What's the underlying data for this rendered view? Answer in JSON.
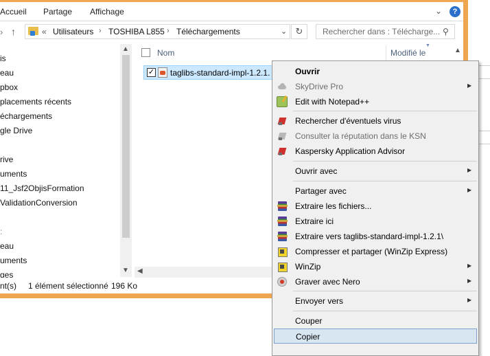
{
  "ribbon": {
    "tabs": [
      "Accueil",
      "Partage",
      "Affichage"
    ],
    "expand_icon": "chevron-down-icon",
    "help_glyph": "?"
  },
  "address": {
    "prefix": "«",
    "crumbs": [
      "Utilisateurs",
      "TOSHIBA L855",
      "Téléchargements"
    ],
    "separator": "›",
    "refresh_icon": "refresh-icon"
  },
  "search": {
    "placeholder": "Rechercher dans : Télécharge..."
  },
  "nav": {
    "items": [
      "is",
      "eau",
      "pbox",
      "placements récents",
      "échargements",
      "gle Drive",
      "",
      "rive",
      "uments",
      "11_Jsf2ObjisFormation",
      "ValidationConversion",
      "",
      "",
      "eau",
      "uments",
      "ges"
    ]
  },
  "files": {
    "columns": {
      "name": "Nom",
      "date": "Modifié le"
    },
    "rows": [
      {
        "name": "taglibs-standard-impl-1.2.1.",
        "checked": true
      }
    ]
  },
  "status": {
    "left": "nt(s)",
    "selection": "1 élément sélectionné",
    "size": "196 Ko"
  },
  "context_menu": {
    "items": [
      {
        "label": "Ouvrir",
        "bold": true,
        "icon": ""
      },
      {
        "label": "SkyDrive Pro",
        "disabled": true,
        "submenu": true,
        "icon": "cloud-icon"
      },
      {
        "label": "Edit with Notepad++",
        "icon": "notepad-plus-plus-icon"
      },
      {
        "label": "Rechercher d'éventuels virus",
        "icon": "kaspersky-icon"
      },
      {
        "label": "Consulter la réputation dans le KSN",
        "disabled": true,
        "icon": "kaspersky-icon"
      },
      {
        "label": "Kaspersky Application Advisor",
        "icon": "kaspersky-icon"
      },
      {
        "label": "Ouvrir avec",
        "submenu": true,
        "icon": ""
      },
      {
        "label": "Partager avec",
        "submenu": true,
        "icon": ""
      },
      {
        "label": "Extraire les fichiers...",
        "icon": "winrar-icon"
      },
      {
        "label": "Extraire ici",
        "icon": "winrar-icon"
      },
      {
        "label": "Extraire vers taglibs-standard-impl-1.2.1\\",
        "icon": "winrar-icon"
      },
      {
        "label": "Compresser et partager (WinZip Express)",
        "icon": "winzip-icon"
      },
      {
        "label": "WinZip",
        "submenu": true,
        "icon": "winzip-icon"
      },
      {
        "label": "Graver avec Nero",
        "submenu": true,
        "icon": "nero-icon"
      },
      {
        "label": "Envoyer vers",
        "submenu": true,
        "icon": ""
      },
      {
        "label": "Couper",
        "icon": ""
      },
      {
        "label": "Copier",
        "selected": true,
        "icon": ""
      }
    ]
  },
  "colors": {
    "window_frame": "#f0a550",
    "selection_fill": "#cce8ff",
    "menu_background": "#f0f0f0",
    "menu_highlight": "#d8e6f2"
  }
}
